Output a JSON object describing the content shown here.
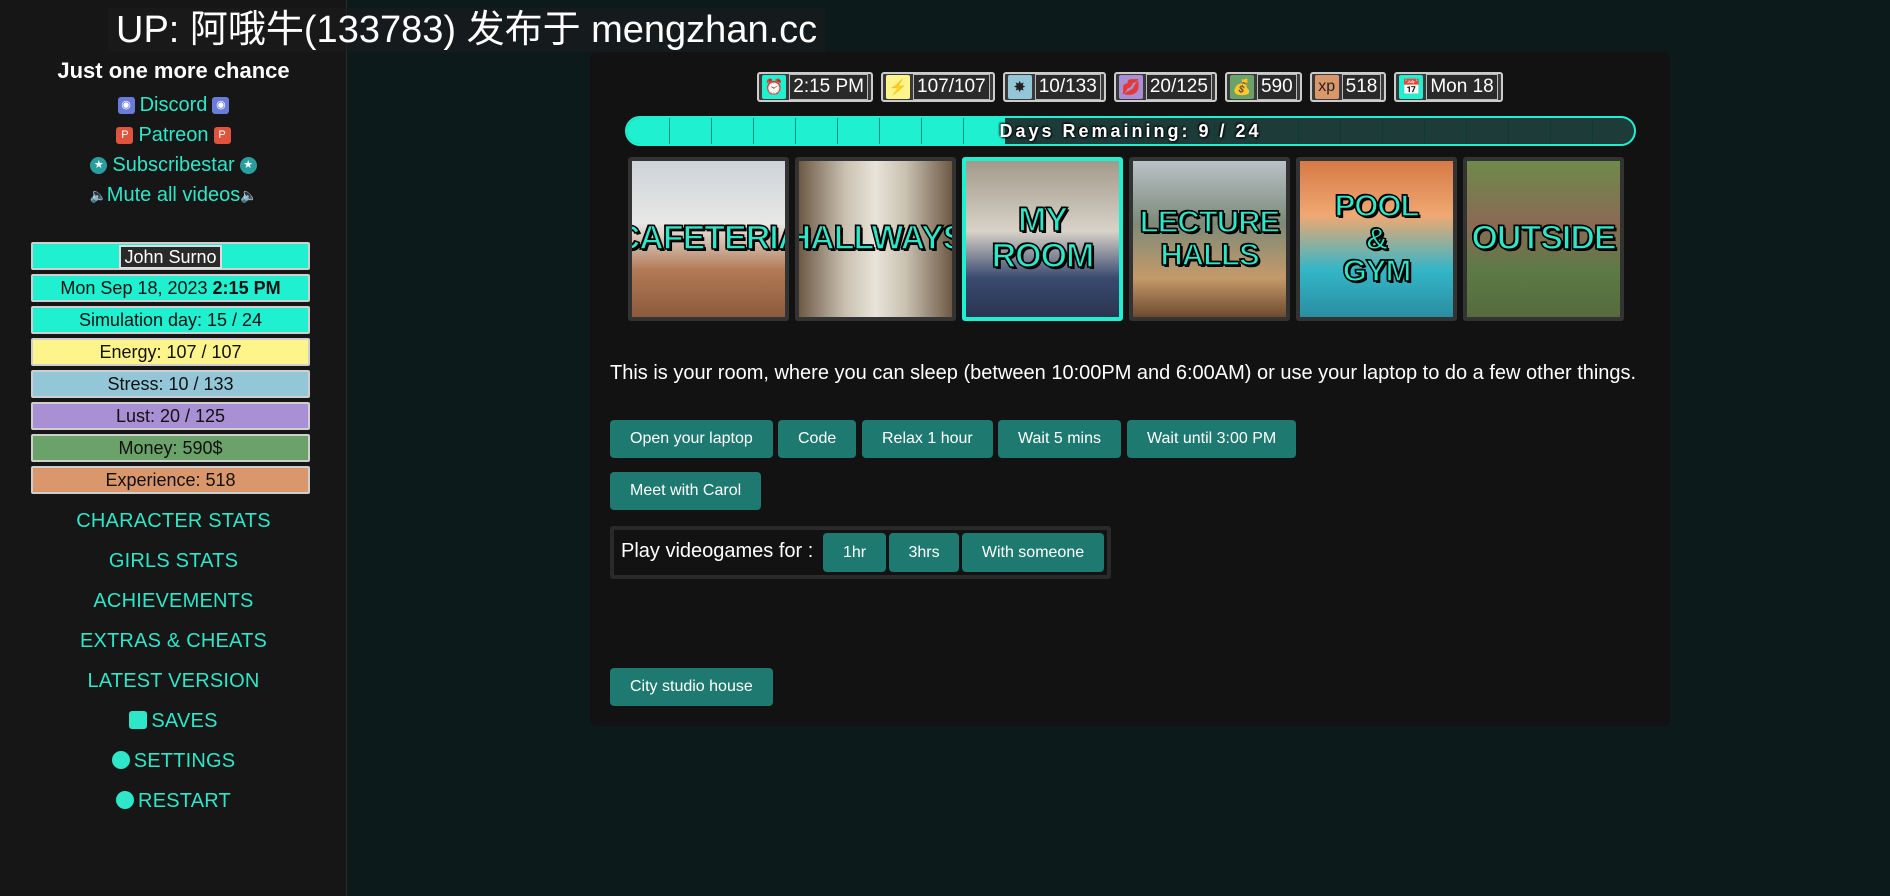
{
  "watermark": "UP: 阿哦牛(133783) 发布于 mengzhan.cc",
  "sidebar": {
    "title": "Just one more chance",
    "links": [
      {
        "label": "Discord",
        "icon": "discord-icon"
      },
      {
        "label": "Patreon",
        "icon": "patreon-icon"
      },
      {
        "label": "Subscribestar",
        "icon": "subscribestar-icon"
      },
      {
        "label": "Mute all videos",
        "icon": "speaker-icon"
      }
    ],
    "player_name": "John Surno",
    "date_prefix": "Mon Sep 18, 2023",
    "date_time": "2:15 PM",
    "stats": {
      "simulation": "Simulation day: 15 / 24",
      "energy": "Energy: 107 / 107",
      "stress": "Stress: 10 / 133",
      "lust": "Lust: 20 / 125",
      "money": "Money: 590$",
      "experience": "Experience: 518"
    },
    "nav": {
      "character_stats": "CHARACTER STATS",
      "girls_stats": "GIRLS STATS",
      "achievements": "ACHIEVEMENTS",
      "extras": "EXTRAS & CHEATS",
      "latest": "LATEST VERSION",
      "saves": "SAVES",
      "settings": "SETTINGS",
      "restart": "RESTART"
    }
  },
  "hud": {
    "time": "2:15 PM",
    "energy": "107/107",
    "stress": "10/133",
    "lust": "20/125",
    "money": "590",
    "xp": "518",
    "xp_icon": "xp",
    "day": "Mon 18"
  },
  "progress": {
    "label": "Days Remaining: 9 / 24",
    "fraction": 0.375,
    "segments": 24
  },
  "locations": [
    {
      "label": "CAFETERIA",
      "active": false
    },
    {
      "label": "HALLWAYS",
      "active": false
    },
    {
      "label": "MY ROOM",
      "active": true
    },
    {
      "label": "LECTURE\nHALLS",
      "active": false
    },
    {
      "label": "POOL\n&\nGYM",
      "active": false
    },
    {
      "label": "OUTSIDE",
      "active": false
    }
  ],
  "description": "This is your room, where you can sleep (between 10:00PM and 6:00AM) or use your laptop to do a few other things.",
  "actions": {
    "open_laptop": "Open your laptop",
    "code": "Code",
    "relax": "Relax 1 hour",
    "wait5": "Wait 5 mins",
    "wait_until": "Wait until 3:00 PM",
    "meet_carol": "Meet with Carol",
    "city_studio": "City studio house"
  },
  "videogames": {
    "label": "Play videogames for :",
    "one_hr": "1hr",
    "three_hrs": "3hrs",
    "with_someone": "With someone"
  },
  "colors": {
    "accent": "#1ff0d0",
    "button": "#1e7a70",
    "energy": "#fdf58b",
    "stress": "#93c7d8",
    "lust": "#a98fd4",
    "money": "#6aa26a",
    "experience": "#d9976b"
  }
}
